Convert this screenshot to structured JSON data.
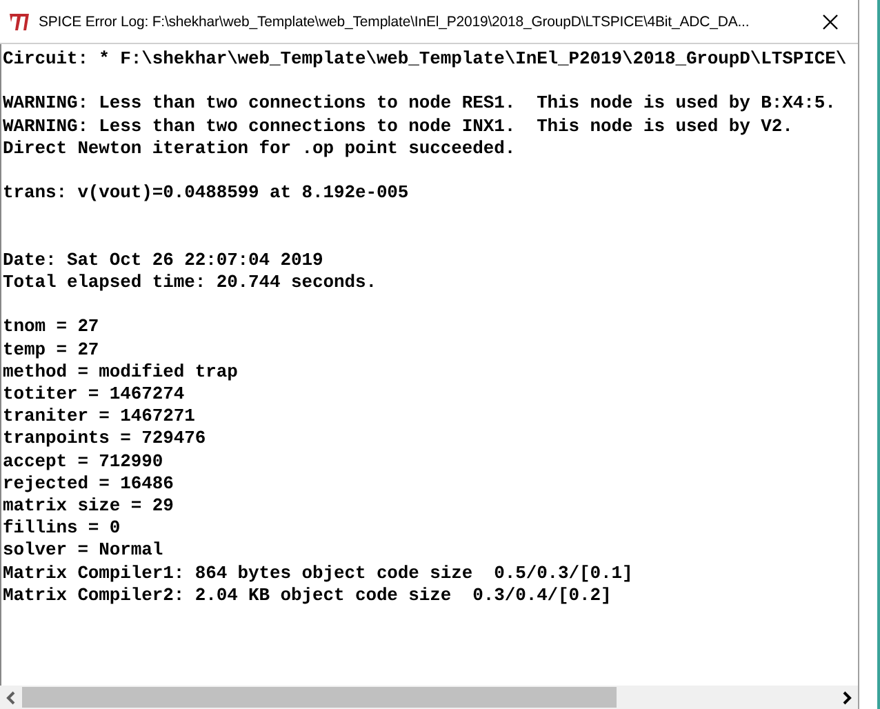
{
  "window": {
    "title": "SPICE Error Log: F:\\shekhar\\web_Template\\web_Template\\InEl_P2019\\2018_GroupD\\LTSPICE\\4Bit_ADC_DA..."
  },
  "log_blocks": [
    {
      "lines": [
        "Circuit: * F:\\shekhar\\web_Template\\web_Template\\InEl_P2019\\2018_GroupD\\LTSPICE\\"
      ]
    },
    {
      "lines": [
        "WARNING: Less than two connections to node RES1.  This node is used by B:X4:5.",
        "WARNING: Less than two connections to node INX1.  This node is used by V2.",
        "Direct Newton iteration for .op point succeeded."
      ]
    },
    {
      "lines": [
        "trans: v(vout)=0.0488599 at 8.192e-005"
      ]
    },
    {
      "lines": [
        "Date: Sat Oct 26 22:07:04 2019",
        "Total elapsed time: 20.744 seconds."
      ]
    },
    {
      "lines": [
        "tnom = 27",
        "temp = 27",
        "method = modified trap",
        "totiter = 1467274",
        "traniter = 1467271",
        "tranpoints = 729476",
        "accept = 712990",
        "rejected = 16486",
        "matrix size = 29",
        "fillins = 0",
        "solver = Normal",
        "Matrix Compiler1: 864 bytes object code size  0.5/0.3/[0.1]",
        "Matrix Compiler2: 2.04 KB object code size  0.3/0.4/[0.2]"
      ]
    }
  ]
}
